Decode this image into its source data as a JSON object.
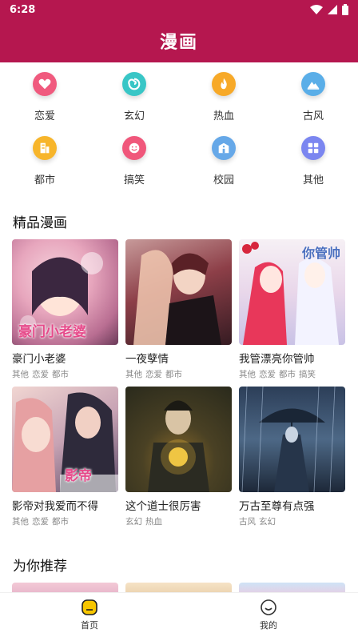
{
  "status_bar": {
    "time": "6:28"
  },
  "app_bar": {
    "title": "漫画"
  },
  "categories": [
    {
      "label": "恋爱",
      "icon": "heart-icon",
      "color": "#f05a7e"
    },
    {
      "label": "玄幻",
      "icon": "swirl-icon",
      "color": "#38c6c6"
    },
    {
      "label": "热血",
      "icon": "flame-icon",
      "color": "#f7a928"
    },
    {
      "label": "古风",
      "icon": "mountain-icon",
      "color": "#5aaee8"
    },
    {
      "label": "都市",
      "icon": "building-icon",
      "color": "#f7b52b"
    },
    {
      "label": "搞笑",
      "icon": "smile-icon",
      "color": "#f0577b"
    },
    {
      "label": "校园",
      "icon": "school-icon",
      "color": "#66a8e8"
    },
    {
      "label": "其他",
      "icon": "grid-icon",
      "color": "#7b86f0"
    }
  ],
  "featured": {
    "title": "精品漫画",
    "items": [
      {
        "name": "豪门小老婆",
        "tags": [
          "其他",
          "恋爱",
          "都市"
        ],
        "cover_text": "豪门小老婆"
      },
      {
        "name": "一夜孽情",
        "tags": [
          "其他",
          "恋爱",
          "都市"
        ],
        "cover_text": ""
      },
      {
        "name": "我管漂亮你管帅",
        "tags": [
          "其他",
          "恋爱",
          "都市",
          "搞笑"
        ],
        "cover_text": "你管帅"
      },
      {
        "name": "影帝对我爱而不得",
        "tags": [
          "其他",
          "恋爱",
          "都市"
        ],
        "cover_text": "影帝"
      },
      {
        "name": "这个道士很厉害",
        "tags": [
          "玄幻",
          "热血"
        ],
        "cover_text": ""
      },
      {
        "name": "万古至尊有点强",
        "tags": [
          "古风",
          "玄幻"
        ],
        "cover_text": ""
      }
    ]
  },
  "recommend": {
    "title": "为你推荐"
  },
  "bottom_nav": {
    "home": "首页",
    "mine": "我的",
    "active_color": "#f7c600"
  }
}
